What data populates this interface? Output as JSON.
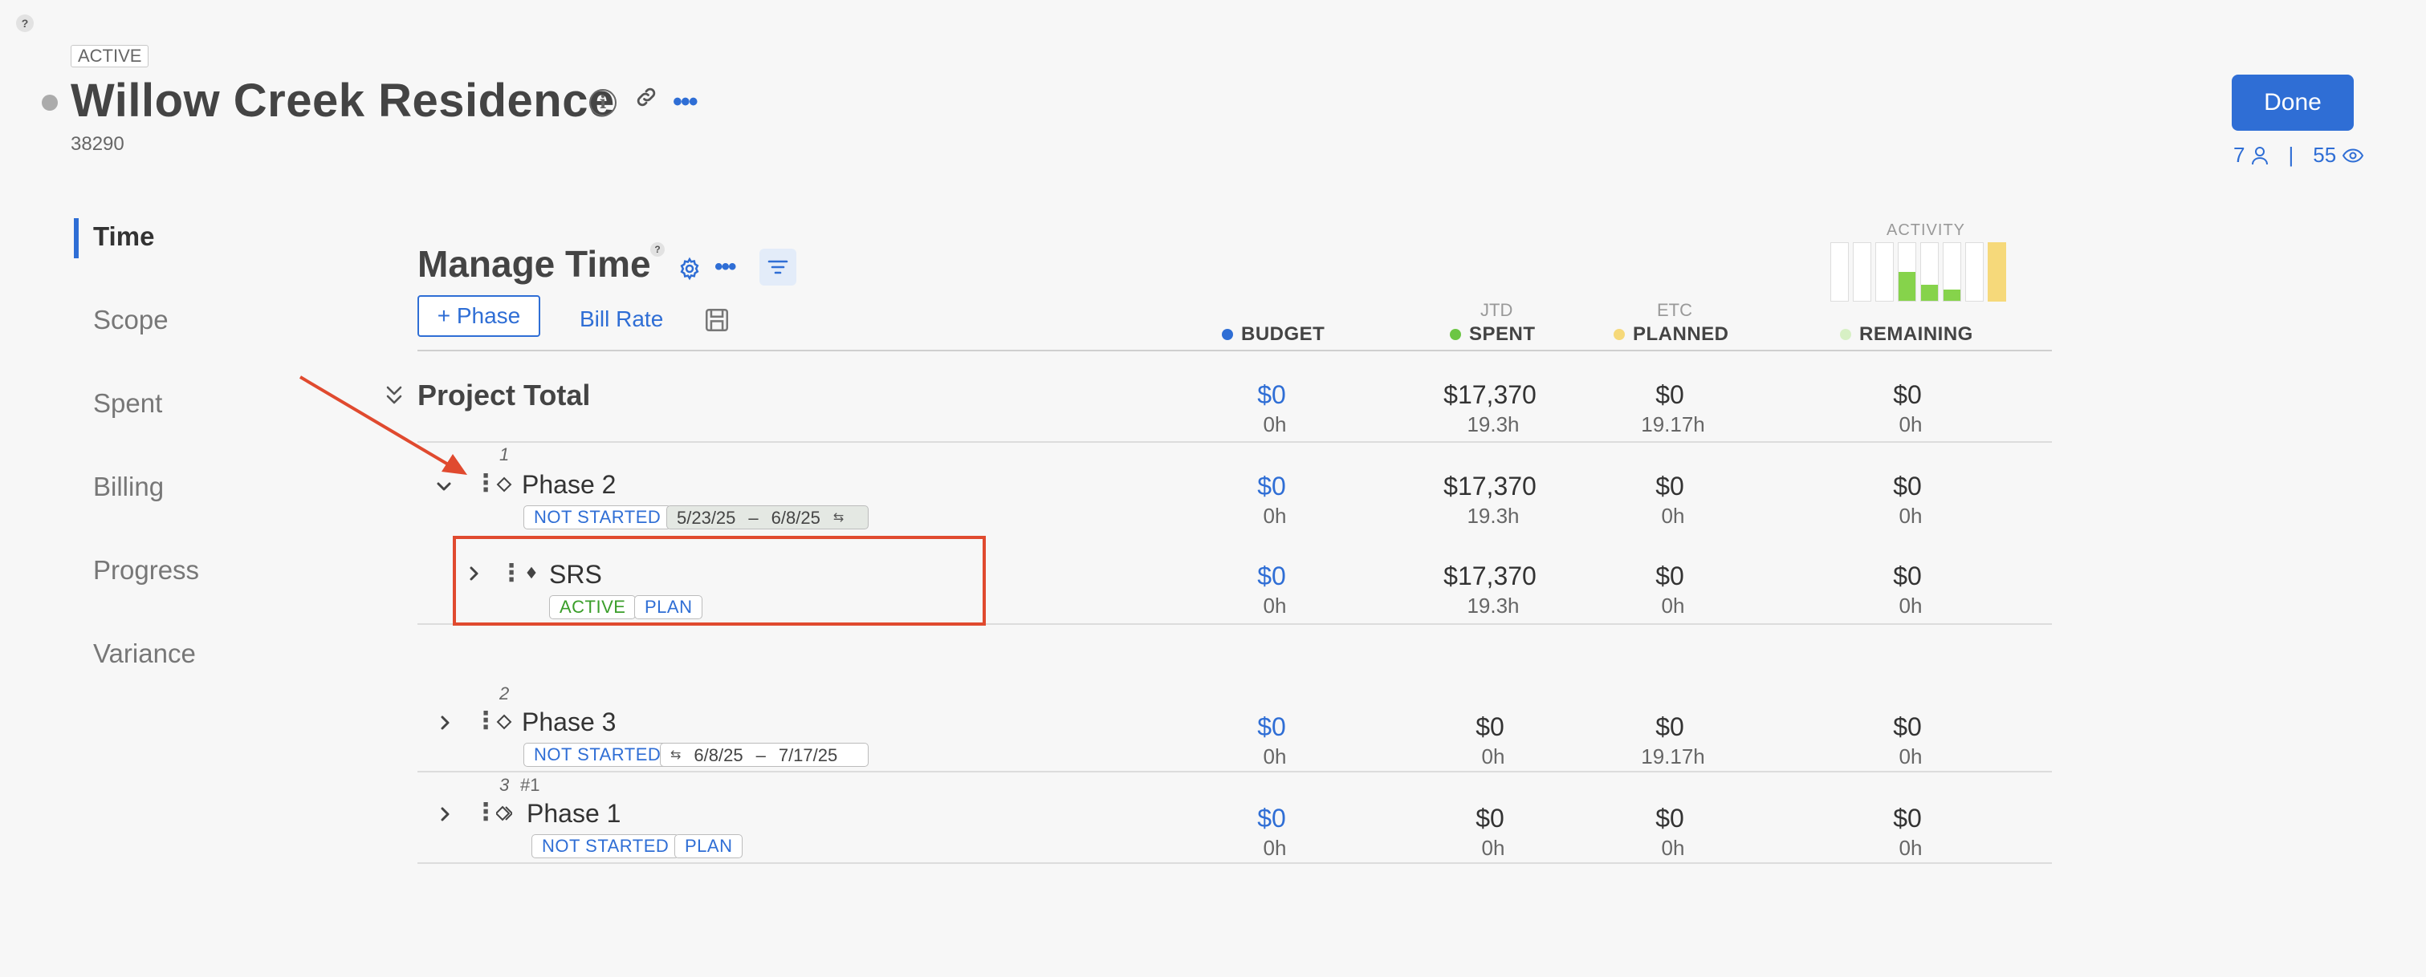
{
  "header": {
    "help": "?",
    "status": "ACTIVE",
    "title": "Willow Creek Residence",
    "project_id": "38290",
    "done_label": "Done",
    "member_count": "7",
    "viewer_count": "55",
    "separator": "|"
  },
  "sidebar": {
    "items": [
      {
        "label": "Time",
        "active": true
      },
      {
        "label": "Scope"
      },
      {
        "label": "Spent"
      },
      {
        "label": "Billing"
      },
      {
        "label": "Progress"
      },
      {
        "label": "Variance"
      }
    ]
  },
  "toolbar": {
    "title": "Manage Time",
    "help": "?",
    "add_phase_label": "+ Phase",
    "bill_rate_label": "Bill Rate"
  },
  "activity": {
    "label": "ACTIVITY",
    "bars": [
      {
        "green": 0,
        "yellow": 0
      },
      {
        "green": 0,
        "yellow": 0
      },
      {
        "green": 0,
        "yellow": 0
      },
      {
        "green": 0.5,
        "yellow": 0
      },
      {
        "green": 0.28,
        "yellow": 0
      },
      {
        "green": 0.2,
        "yellow": 0
      },
      {
        "green": 0,
        "yellow": 0
      },
      {
        "green": 0,
        "yellow": 1
      }
    ],
    "colors": {
      "green": "#86d34b",
      "yellow": "#f6d97a"
    }
  },
  "columns": {
    "budget": {
      "label": "BUDGET",
      "color": "#2f6ed5"
    },
    "spent": {
      "sub": "JTD",
      "label": "SPENT",
      "color": "#6cc644"
    },
    "planned": {
      "sub": "ETC",
      "label": "PLANNED",
      "color": "#f6d97a"
    },
    "remaining": {
      "label": "REMAINING",
      "color": "#d7f0c4"
    }
  },
  "total": {
    "label": "Project Total",
    "budget": "$0",
    "budget_h": "0h",
    "spent": "$17,370",
    "spent_h": "19.3h",
    "planned": "$0",
    "planned_h": "19.17h",
    "remaining": "$0",
    "remaining_h": "0h"
  },
  "rows": [
    {
      "num": "1",
      "name": "Phase 2",
      "status": "NOT STARTED",
      "date_start": "5/23/25",
      "date_dash": "–",
      "date_end": "6/8/25",
      "budget": "$0",
      "budget_h": "0h",
      "spent": "$17,370",
      "spent_h": "19.3h",
      "planned": "$0",
      "planned_h": "0h",
      "remaining": "$0",
      "remaining_h": "0h"
    },
    {
      "name": "SRS",
      "status": "ACTIVE",
      "tag": "PLAN",
      "budget": "$0",
      "budget_h": "0h",
      "spent": "$17,370",
      "spent_h": "19.3h",
      "planned": "$0",
      "planned_h": "0h",
      "remaining": "$0",
      "remaining_h": "0h"
    },
    {
      "num": "2",
      "name": "Phase 3",
      "status": "NOT STARTED",
      "date_start": "6/8/25",
      "date_dash": "–",
      "date_end": "7/17/25",
      "budget": "$0",
      "budget_h": "0h",
      "spent": "$0",
      "spent_h": "0h",
      "planned": "$0",
      "planned_h": "19.17h",
      "remaining": "$0",
      "remaining_h": "0h"
    },
    {
      "num": "3",
      "ref": "#1",
      "name": "Phase 1",
      "status": "NOT STARTED",
      "tag": "PLAN",
      "budget": "$0",
      "budget_h": "0h",
      "spent": "$0",
      "spent_h": "0h",
      "planned": "$0",
      "planned_h": "0h",
      "remaining": "$0",
      "remaining_h": "0h"
    }
  ],
  "colors": {
    "accent": "#2f6ed5",
    "annotation": "#e04a2f"
  }
}
